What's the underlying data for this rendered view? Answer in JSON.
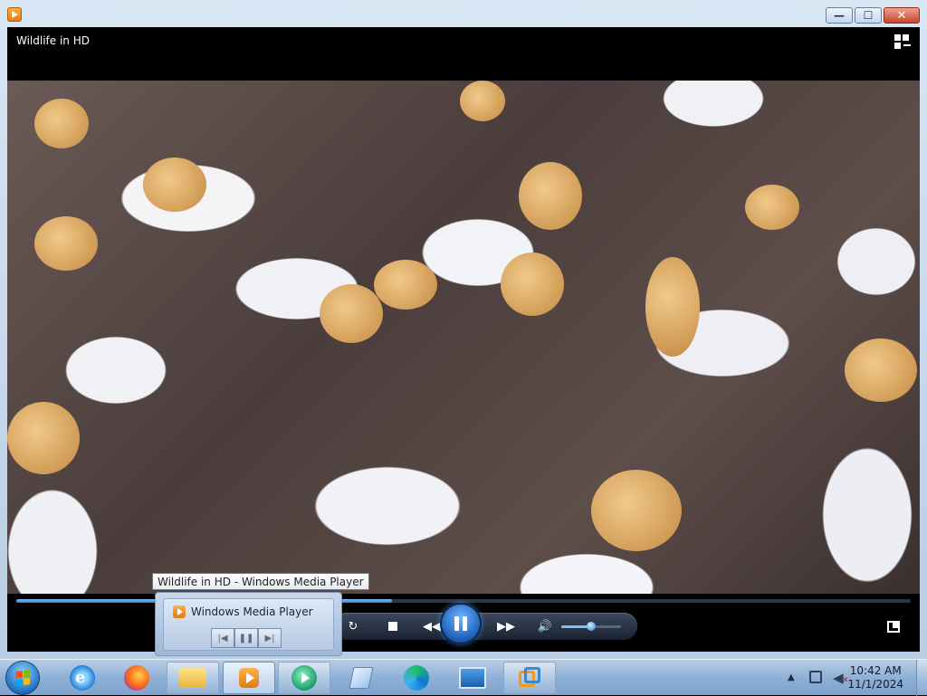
{
  "window": {
    "title": "Wildlife in HD",
    "app_icon": "windows-media-player-icon",
    "minimize_glyph": "—",
    "maximize_glyph": "☐",
    "close_glyph": "✕"
  },
  "player": {
    "switch_to_library_icon": "switch-to-library-icon",
    "seek_progress": 0.42,
    "volume_level": 0.5,
    "colors": {
      "accent": "#2f7fd1",
      "control_bar": "#1a2230"
    }
  },
  "tooltip": {
    "text": "Wildlife in HD - Windows Media Player"
  },
  "thumbnail": {
    "title": "Windows Media Player"
  },
  "taskbar": {
    "items": [
      {
        "name": "internet-explorer",
        "icon": "internet-explorer-icon"
      },
      {
        "name": "firefox",
        "icon": "firefox-icon"
      },
      {
        "name": "file-explorer",
        "icon": "folder-icon"
      },
      {
        "name": "windows-media-player",
        "icon": "media-player-icon"
      },
      {
        "name": "media-center",
        "icon": "media-center-icon"
      },
      {
        "name": "notepad",
        "icon": "notepad-icon"
      },
      {
        "name": "edge",
        "icon": "edge-icon"
      },
      {
        "name": "remote-desktop",
        "icon": "remote-desktop-icon"
      },
      {
        "name": "vmware",
        "icon": "vmware-icon"
      }
    ],
    "clock": {
      "time": "10:42 AM",
      "date": "11/1/2024"
    }
  }
}
